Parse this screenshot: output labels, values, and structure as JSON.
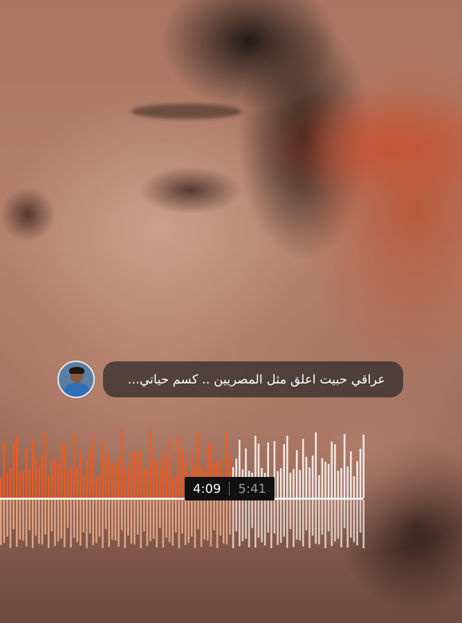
{
  "message": {
    "text": "عراقي حبيت اعلق مثل المصريين .. كسم حياتي..."
  },
  "player": {
    "current_time": "4:09",
    "total_time": "5:41",
    "progress": 0.732,
    "played_color": "#f25a1c",
    "unplayed_color": "#ffffff"
  }
}
